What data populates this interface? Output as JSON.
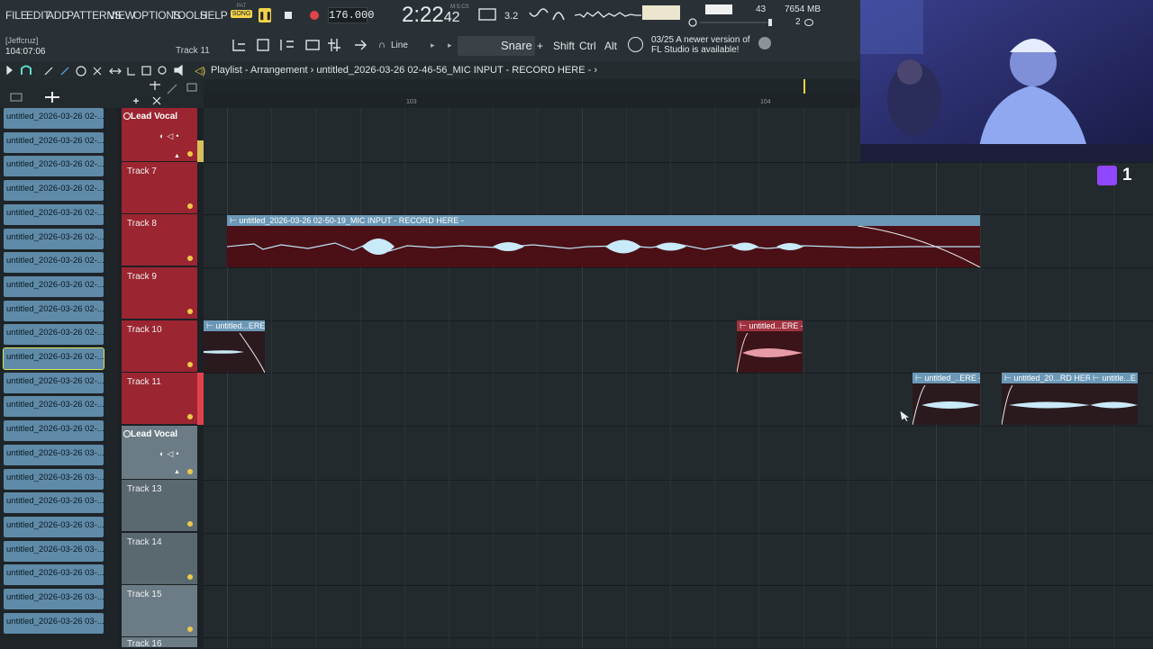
{
  "menu": [
    "FILE",
    "EDIT",
    "ADD",
    "PATTERNS",
    "VIEW",
    "OPTIONS",
    "TOOLS",
    "HELP"
  ],
  "transport": {
    "pat_label": "PAT",
    "song_label": "SONG",
    "tempo": "176.000",
    "time_main": "2:22",
    "time_sub": "42",
    "time_mode": "M:S:CS",
    "cpu": "43",
    "memory": "7654 MB",
    "polyphony": "2"
  },
  "toolbar2": {
    "user": "[Jeffcruz]",
    "clock": "104:07:06",
    "track_hint": "Track 11",
    "snap": "Line",
    "instrument": "Snare",
    "add": "+",
    "keys": [
      "Shift",
      "Ctrl",
      "Alt"
    ],
    "news_date": "03/25",
    "news_text": "A newer version of FL Studio is available!"
  },
  "playlist": {
    "title": "Playlist - Arrangement",
    "sep": "›",
    "pattern": "untitled_2026-03-26 02-46-56_MIC INPUT - RECORD HERE -",
    "ruler": [
      "103",
      "104"
    ]
  },
  "picker": [
    "untitled_2026-03-26 02-...",
    "untitled_2026-03-26 02-...",
    "untitled_2026-03-26 02-...",
    "untitled_2026-03-26 02-...",
    "untitled_2026-03-26 02-...",
    "untitled_2026-03-26 02-...",
    "untitled_2026-03-26 02-...",
    "untitled_2026-03-26 02-...",
    "untitled_2026-03-26 02-...",
    "untitled_2026-03-26 02-...",
    "untitled_2026-03-26 02-...",
    "untitled_2026-03-26 02-...",
    "untitled_2026-03-26 02-...",
    "untitled_2026-03-26 02-...",
    "untitled_2026-03-26 03-...",
    "untitled_2026-03-26 03-...",
    "untitled_2026-03-26 03-...",
    "untitled_2026-03-26 03-...",
    "untitled_2026-03-26 03-...",
    "untitled_2026-03-26 03-...",
    "untitled_2026-03-26 03-...",
    "untitled_2026-03-26 03-..."
  ],
  "tracks": {
    "group1": "Lead Vocal",
    "t7": "Track 7",
    "t8": "Track 8",
    "t9": "Track 9",
    "t10": "Track 10",
    "t11": "Track 11",
    "group2": "Lead Vocal",
    "t13": "Track 13",
    "t14": "Track 14",
    "t15": "Track 15",
    "t16": "Track 16"
  },
  "clips": {
    "c1": "⊢ untitled_2026-03-26 02-50-19_MIC INPUT - RECORD HERE -",
    "c2": "⊢ untitled...ERE -",
    "c3": "⊢ untitled...ERE -",
    "c4": "⊢ untitled_..ERE -",
    "c5": "⊢ untitled_20...RD HERE -",
    "c6": "⊢ untitle...E -"
  },
  "overlay": {
    "viewer_count": "1"
  },
  "colors": {
    "accent_yellow": "#f2d34a",
    "track_red": "#9b2530",
    "clip_blue": "#6b98b6",
    "clip_red": "#a03240",
    "twitch": "#9146ff"
  }
}
